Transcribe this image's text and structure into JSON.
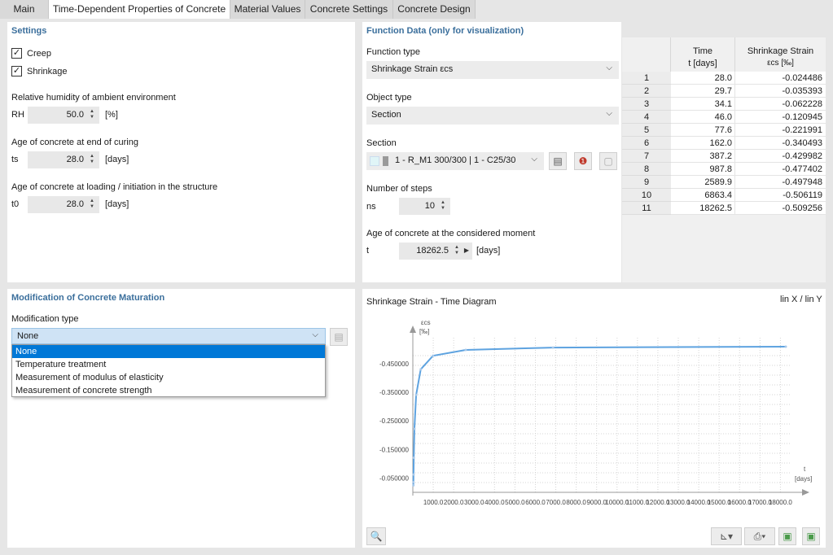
{
  "tabs": [
    "Main",
    "Time-Dependent Properties of Concrete",
    "Material Values",
    "Concrete Settings",
    "Concrete Design"
  ],
  "settings": {
    "title": "Settings",
    "creep_label": "Creep",
    "creep_checked": true,
    "shrinkage_label": "Shrinkage",
    "shrinkage_checked": true,
    "rh_heading": "Relative humidity of ambient environment",
    "rh_symbol": "RH",
    "rh_value": "50.0",
    "rh_unit": "[%]",
    "ts_heading": "Age of concrete at end of curing",
    "ts_symbol": "ts",
    "ts_value": "28.0",
    "ts_unit": "[days]",
    "t0_heading": "Age of concrete at loading / initiation in the structure",
    "t0_symbol": "t0",
    "t0_value": "28.0",
    "t0_unit": "[days]"
  },
  "function_data": {
    "title": "Function Data (only for visualization)",
    "function_type_label": "Function type",
    "function_type_value": "Shrinkage Strain εcs",
    "object_type_label": "Object type",
    "object_type_value": "Section",
    "section_label": "Section",
    "section_value": "1 - R_M1 300/300 | 1 - C25/30",
    "steps_label": "Number of steps",
    "steps_symbol": "ns",
    "steps_value": "10",
    "age_label": "Age of concrete at the considered moment",
    "age_symbol": "t",
    "age_value": "18262.5",
    "age_unit": "[days]"
  },
  "table": {
    "col1_header": "Time",
    "col1_sub": "t [days]",
    "col2_header": "Shrinkage Strain",
    "col2_sub": "εcs [‰]",
    "rows": [
      {
        "n": "1",
        "t": "28.0",
        "e": "-0.024486"
      },
      {
        "n": "2",
        "t": "29.7",
        "e": "-0.035393"
      },
      {
        "n": "3",
        "t": "34.1",
        "e": "-0.062228"
      },
      {
        "n": "4",
        "t": "46.0",
        "e": "-0.120945"
      },
      {
        "n": "5",
        "t": "77.6",
        "e": "-0.221991"
      },
      {
        "n": "6",
        "t": "162.0",
        "e": "-0.340493"
      },
      {
        "n": "7",
        "t": "387.2",
        "e": "-0.429982"
      },
      {
        "n": "8",
        "t": "987.8",
        "e": "-0.477402"
      },
      {
        "n": "9",
        "t": "2589.9",
        "e": "-0.497948"
      },
      {
        "n": "10",
        "t": "6863.4",
        "e": "-0.506119"
      },
      {
        "n": "11",
        "t": "18262.5",
        "e": "-0.509256"
      }
    ]
  },
  "maturation": {
    "title": "Modification of Concrete Maturation",
    "type_label": "Modification type",
    "type_value": "None",
    "options": [
      "None",
      "Temperature treatment",
      "Measurement of modulus of elasticity",
      "Measurement of concrete strength"
    ]
  },
  "chart_data": {
    "type": "line",
    "title": "Shrinkage Strain - Time Diagram",
    "scale_label": "lin X / lin Y",
    "ylabel": "εcs",
    "yunit": "[‰]",
    "xlabel": "t",
    "xunit": "[days]",
    "y_ticks": [
      "-0.450000",
      "-0.350000",
      "-0.250000",
      "-0.150000",
      "-0.050000"
    ],
    "x_ticks": [
      "1000.0",
      "2000.0",
      "3000.0",
      "4000.0",
      "5000.0",
      "6000.0",
      "7000.0",
      "8000.0",
      "9000.0",
      "10000.0",
      "11000.0",
      "12000.0",
      "13000.0",
      "14000.0",
      "15000.0",
      "16000.0",
      "17000.0",
      "18000.0"
    ],
    "xlim": [
      0,
      18262.5
    ],
    "ylim": [
      0,
      -0.5092
    ],
    "series": [
      {
        "x": [
          28.0,
          29.7,
          34.1,
          46.0,
          77.6,
          162.0,
          387.2,
          987.8,
          2589.9,
          6863.4,
          18262.5
        ],
        "y": [
          -0.024486,
          -0.035393,
          -0.062228,
          -0.120945,
          -0.221991,
          -0.340493,
          -0.429982,
          -0.477402,
          -0.497948,
          -0.506119,
          -0.509256
        ]
      }
    ],
    "line_color": "#5ea3e0"
  }
}
